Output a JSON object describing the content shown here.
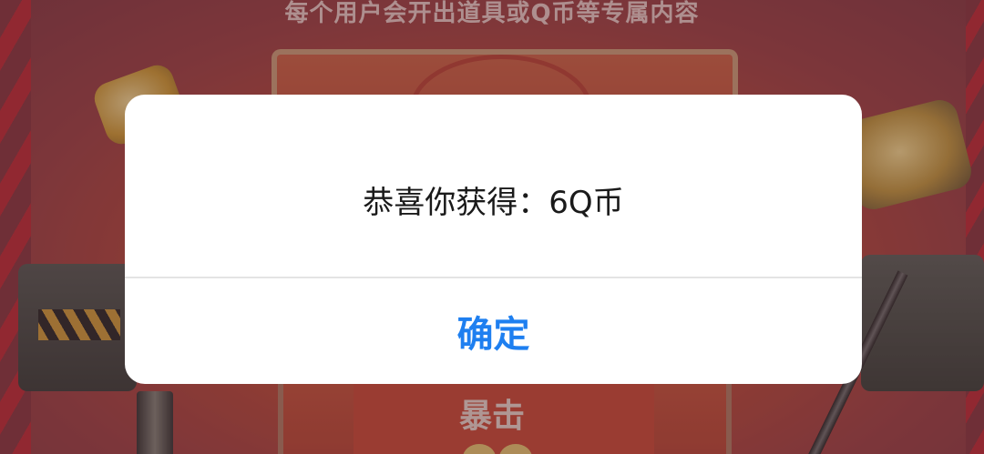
{
  "background": {
    "headline": "每个用户会开出道具或Q币等专属内容",
    "label": "暴击"
  },
  "dialog": {
    "message": "恭喜你获得：6Q币",
    "confirm_label": "确定"
  },
  "colors": {
    "confirm_text": "#1e7ff0",
    "dialog_bg": "#ffffff",
    "message_text": "#1a1a1a"
  }
}
